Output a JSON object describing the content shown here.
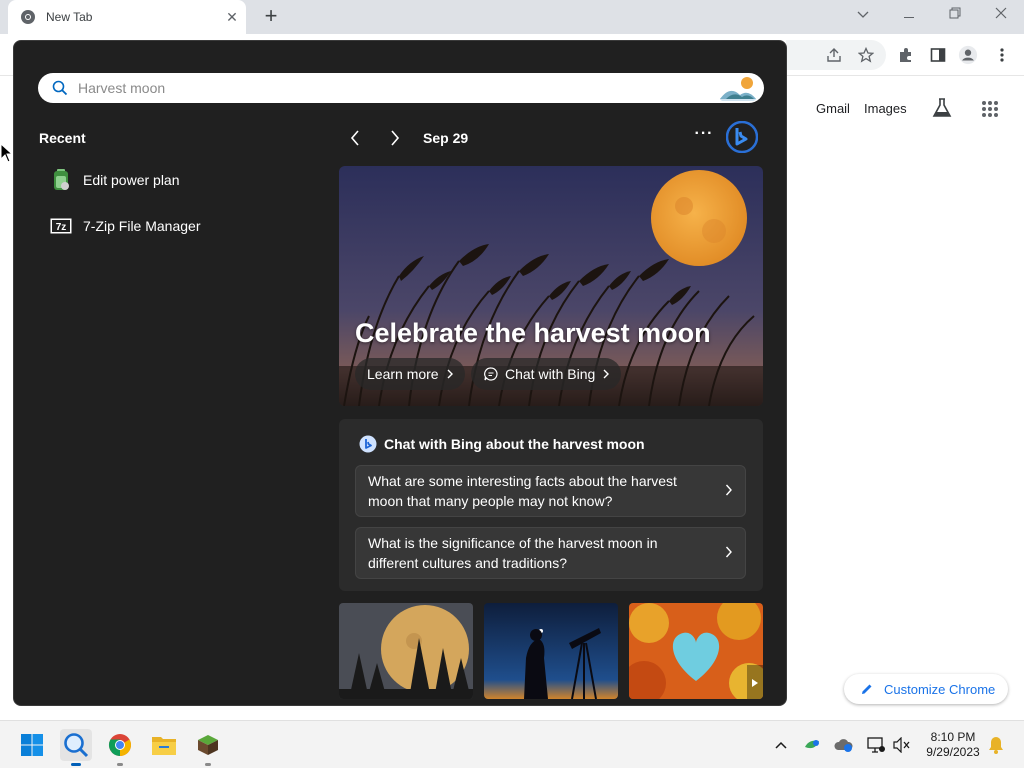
{
  "browser": {
    "tab_title": "New Tab",
    "new_tab_symbol": "+",
    "ntp_links": {
      "gmail": "Gmail",
      "images": "Images"
    },
    "customize_label": "Customize Chrome"
  },
  "search": {
    "placeholder": "Harvest moon"
  },
  "recent": {
    "title": "Recent",
    "items": [
      {
        "label": "Edit power plan",
        "icon": "battery-settings-icon"
      },
      {
        "label": "7-Zip File Manager",
        "icon": "7zip-icon"
      }
    ]
  },
  "highlights": {
    "date": "Sep 29",
    "more_label": "···",
    "hero_title": "Celebrate the harvest moon",
    "learn_more": "Learn more",
    "chat_with_bing": "Chat with Bing"
  },
  "chat_card": {
    "title": "Chat with Bing about the harvest moon",
    "suggestions": [
      "What are some interesting facts about the harvest moon that many people may not know?",
      "What is the significance of the harvest moon in different cultures and traditions?"
    ]
  },
  "taskbar": {
    "time": "8:10 PM",
    "date": "9/29/2023",
    "apps": [
      "start-icon",
      "search-icon",
      "chrome-icon",
      "file-explorer-icon",
      "minecraft-icon"
    ]
  },
  "colors": {
    "flyout_bg": "#202020",
    "accent": "#1a73e8",
    "taskbar_bg": "#f3f3f3",
    "moon": "#f0a53a"
  }
}
